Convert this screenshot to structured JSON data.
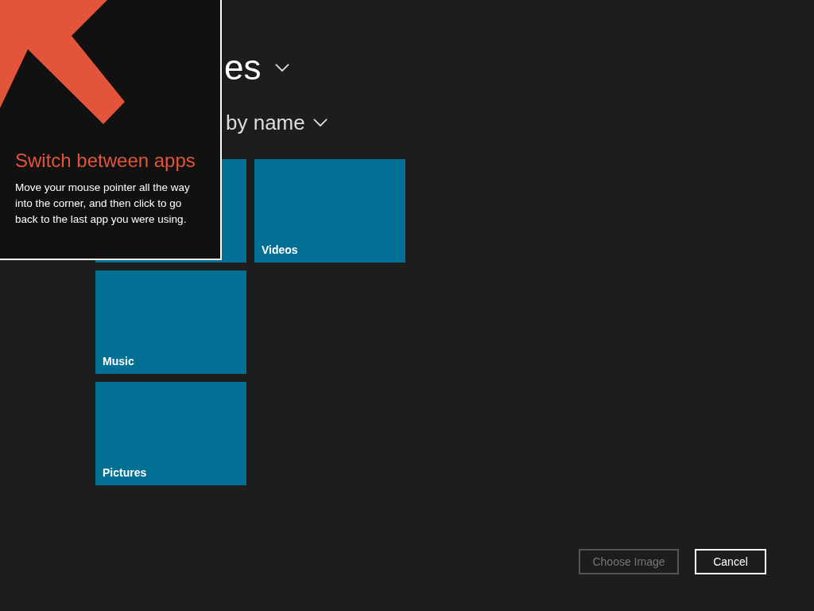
{
  "header": {
    "title": "es",
    "sort": "by name"
  },
  "tiles": [
    {
      "kind": "tile"
    },
    {
      "kind": "tile",
      "label": "Music"
    },
    {
      "kind": "tile",
      "label": "Pictures"
    },
    {
      "kind": "tile",
      "label": "Videos"
    }
  ],
  "buttons": [
    {
      "label": "Choose Image",
      "disabled": true
    },
    {
      "label": "Cancel",
      "disabled": false
    }
  ],
  "tip": {
    "title": "Switch between apps",
    "text": "Move your mouse pointer all the way into the corner, and then click to go back to the last app you were using."
  }
}
